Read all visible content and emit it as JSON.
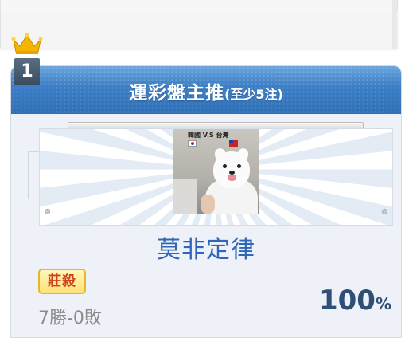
{
  "panel": {
    "title": "運彩盤主推",
    "subtitle": "(至少5注)"
  },
  "entry": {
    "rank": "1",
    "photo_caption": "韓國 V.S 台灣",
    "username": "莫非定律",
    "tag": "莊殺",
    "record": "7勝-0敗",
    "win_rate": "100",
    "win_rate_unit": "%"
  },
  "colors": {
    "header_blue": "#3d7fc6",
    "username_blue": "#2f66b8",
    "rate_navy": "#2f4f77",
    "badge_yellow": "#ffe27a",
    "badge_red": "#d0401a",
    "crown_gold": "#f4b400"
  },
  "icons": {
    "crown": "crown-icon"
  }
}
